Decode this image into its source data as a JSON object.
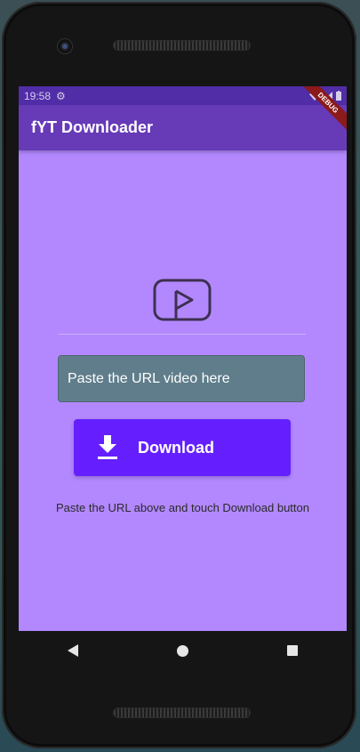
{
  "statusbar": {
    "time": "19:58",
    "wifi_icon": "wifi-icon",
    "signal_icon": "signal-icon",
    "battery_icon": "battery-icon"
  },
  "appbar": {
    "title": "fYT Downloader"
  },
  "debug_banner": {
    "label": "DEBUG"
  },
  "main": {
    "url_input": {
      "placeholder": "Paste the URL video here"
    },
    "download_button": {
      "label": "Download"
    },
    "hint": "Paste the URL above and touch Download button"
  },
  "colors": {
    "statusbar": "#512da8",
    "appbar": "#673ab7",
    "background": "#b388ff",
    "input": "#607d8b",
    "button": "#651fff"
  }
}
